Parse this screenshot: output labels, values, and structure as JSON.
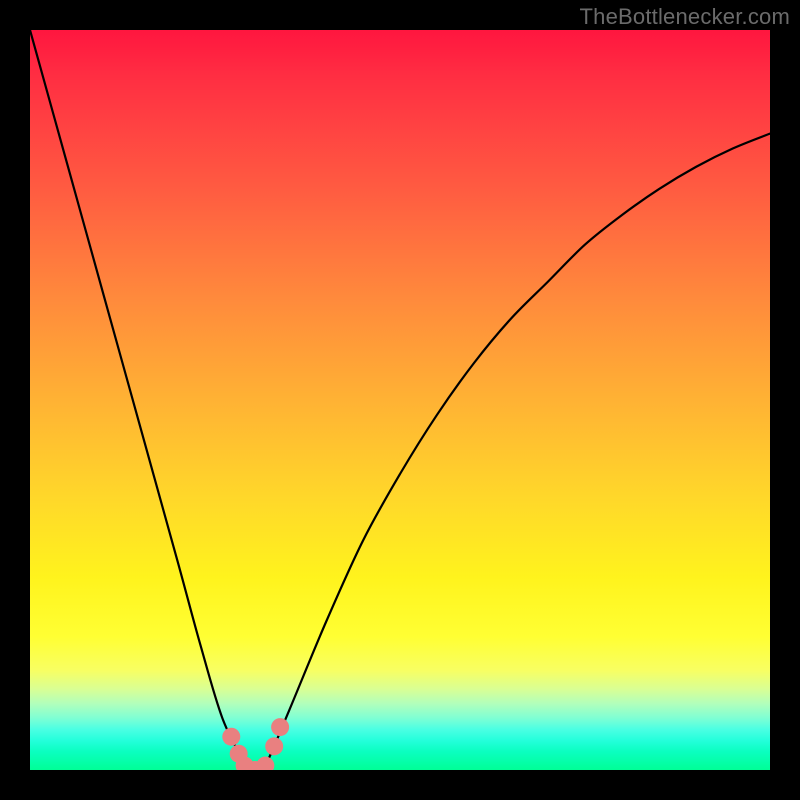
{
  "watermark": "TheBottlenecker.com",
  "chart_data": {
    "type": "line",
    "title": "",
    "xlabel": "",
    "ylabel": "",
    "xlim": [
      0,
      100
    ],
    "ylim": [
      0,
      100
    ],
    "series": [
      {
        "name": "bottleneck-curve",
        "color": "#000000",
        "x": [
          0,
          5,
          10,
          15,
          20,
          23,
          26,
          29,
          30,
          31,
          32,
          35,
          40,
          45,
          50,
          55,
          60,
          65,
          70,
          75,
          80,
          85,
          90,
          95,
          100
        ],
        "y": [
          100,
          82,
          64,
          46,
          28,
          17,
          7,
          1,
          0,
          0,
          1,
          8,
          20,
          31,
          40,
          48,
          55,
          61,
          66,
          71,
          75,
          78.5,
          81.5,
          84,
          86
        ]
      }
    ],
    "markers": [
      {
        "name": "marker-left-upper",
        "x": 27.2,
        "y": 4.5,
        "color": "#e98080"
      },
      {
        "name": "marker-left-mid",
        "x": 28.2,
        "y": 2.2,
        "color": "#e98080"
      },
      {
        "name": "marker-bottom-1",
        "x": 29.0,
        "y": 0.6,
        "color": "#e98080"
      },
      {
        "name": "marker-bottom-2",
        "x": 30.4,
        "y": 0.0,
        "color": "#e98080"
      },
      {
        "name": "marker-bottom-3",
        "x": 31.8,
        "y": 0.6,
        "color": "#e98080"
      },
      {
        "name": "marker-right-mid",
        "x": 33.0,
        "y": 3.2,
        "color": "#e98080"
      },
      {
        "name": "marker-right-upper",
        "x": 33.8,
        "y": 5.8,
        "color": "#e98080"
      }
    ],
    "background_gradient": {
      "stops": [
        {
          "pos": 0.0,
          "color": "#ff163f"
        },
        {
          "pos": 0.5,
          "color": "#ffb234"
        },
        {
          "pos": 0.82,
          "color": "#ffff33"
        },
        {
          "pos": 1.0,
          "color": "#00ff96"
        }
      ]
    }
  }
}
